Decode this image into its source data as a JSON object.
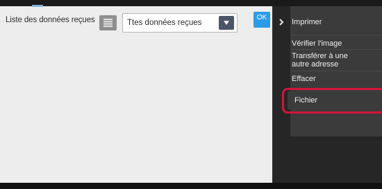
{
  "main": {
    "list_label": "Liste des données reçues",
    "filter_value": "Ttes données reçues",
    "ok_label": "OK"
  },
  "side_menu": {
    "items": [
      {
        "label": "Imprimer"
      },
      {
        "label": "Vérifier l'image"
      },
      {
        "label_line1": "Transférer à une",
        "label_line2": "autre adresse"
      },
      {
        "label": "Effacer"
      },
      {
        "label": "Fichier",
        "highlighted": true
      }
    ]
  },
  "colors": {
    "ok_button": "#2d9be8",
    "highlight_outline": "#d4143c",
    "menu_background": "#3b3b3b",
    "panel_background": "#ededed"
  },
  "icons": {
    "list_view": "list-icon",
    "dropdown": "chevron-down-icon",
    "collapse": "chevron-right-icon"
  }
}
